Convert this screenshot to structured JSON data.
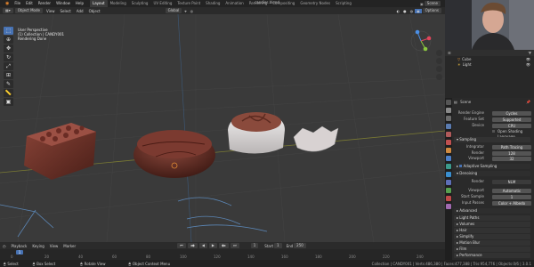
{
  "app": {
    "window_title": "candies.blend",
    "menu": [
      "File",
      "Edit",
      "Render",
      "Window",
      "Help"
    ],
    "workspaces": [
      "Layout",
      "Modeling",
      "Sculpting",
      "UV Editing",
      "Texture Paint",
      "Shading",
      "Animation",
      "Rendering",
      "Compositing",
      "Geometry Nodes",
      "Scripting"
    ],
    "active_workspace": "Layout",
    "scene_label": "Scene",
    "view_layer_label": "ViewLayer"
  },
  "viewport": {
    "mode": "Object Mode",
    "header_menus": [
      "View",
      "Select",
      "Add",
      "Object"
    ],
    "transform": "Global",
    "info_lines": [
      "User Perspective",
      "(1) Collection | CANDY001",
      "Rendering Done"
    ],
    "options_label": "Options"
  },
  "outliner": {
    "items": [
      {
        "label": "Cube",
        "icon": "mesh-icon"
      },
      {
        "label": "Light",
        "icon": "light-icon"
      }
    ]
  },
  "properties": {
    "scene_label": "Scene",
    "rows": [
      {
        "label": "Render Engine",
        "value": "Cycles"
      },
      {
        "label": "Feature Set",
        "value": "Supported"
      },
      {
        "label": "Device",
        "value": "CPU"
      }
    ],
    "osl_label": "Open Shading Language",
    "sampling": {
      "title": "Sampling",
      "integrator_label": "Integrator",
      "integrator_value": "Path Tracing",
      "render_label": "Render",
      "render_value": "128",
      "viewport_label": "Viewport",
      "viewport_value": "32",
      "adaptive_label": "Adaptive Sampling",
      "denoising_label": "Denoising",
      "den_render_label": "Render",
      "den_render_value": "NLM",
      "den_viewport_label": "Viewport",
      "den_viewport_value": "Automatic",
      "start_label": "Start Sample",
      "start_value": "1",
      "input_label": "Input Passes",
      "input_value": "Color + Albedo",
      "advanced_label": "Advanced"
    },
    "panels": [
      "Light Paths",
      "Volumes",
      "Hair",
      "Simplify",
      "Motion Blur",
      "Film",
      "Performance"
    ]
  },
  "timeline": {
    "menus": [
      "Playback",
      "Keying",
      "View",
      "Marker"
    ],
    "frame_labels": [
      "0",
      "20",
      "40",
      "60",
      "80",
      "100",
      "120",
      "140",
      "160",
      "180",
      "200",
      "220",
      "240"
    ],
    "current_frame": "1",
    "start_label": "Start",
    "start_value": "1",
    "end_label": "End",
    "end_value": "250"
  },
  "statusbar": {
    "left": [
      "Select",
      "Box Select",
      "Rotate View",
      "Object Context Menu"
    ],
    "right": "Collection | CANDY001 | Verts:486,380 | Faces:477,388 | Tris:954,776 | Objects:0/6 | 3.0.1"
  }
}
